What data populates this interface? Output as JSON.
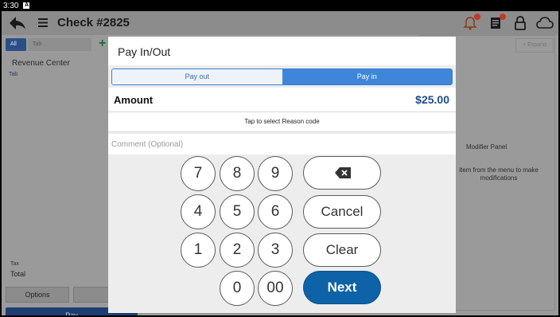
{
  "statusbar": {
    "time": "3:30",
    "badge": "A"
  },
  "header": {
    "title": "Check #2825"
  },
  "left_panel": {
    "tab_all": "All",
    "tab_tab": "Tab",
    "plus": "+",
    "revenue_center": "Revenue Center",
    "revenue_sub": "Tab",
    "tax": "Tax",
    "total": "Total",
    "options": "Options",
    "pay": "Pay"
  },
  "right_panel": {
    "expand": "Expand",
    "modifier_title": "Modifier Panel",
    "modifier_text": "item from the menu to make modifications"
  },
  "modal": {
    "title": "Pay In/Out",
    "segments": {
      "pay_out": "Pay out",
      "pay_in": "Pay in",
      "selected": "Pay in"
    },
    "amount_label": "Amount",
    "amount_value": "$25.00",
    "reason_button": "Tap to select Reason code",
    "comment_placeholder": "Comment (Optional)",
    "keypad": {
      "k7": "7",
      "k8": "8",
      "k9": "9",
      "k4": "4",
      "k5": "5",
      "k6": "6",
      "k1": "1",
      "k2": "2",
      "k3": "3",
      "k0": "0",
      "k00": "00"
    },
    "cancel": "Cancel",
    "clear": "Clear",
    "next": "Next"
  },
  "colors": {
    "accent": "#3e86d9",
    "next": "#0d62a8",
    "amount": "#1f4d8c",
    "notification": "#c0392b"
  },
  "icons": [
    "back-arrow-icon",
    "hamburger-menu-icon",
    "bell-icon",
    "receipt-icon",
    "lock-icon",
    "cloud-icon",
    "backspace-icon"
  ]
}
